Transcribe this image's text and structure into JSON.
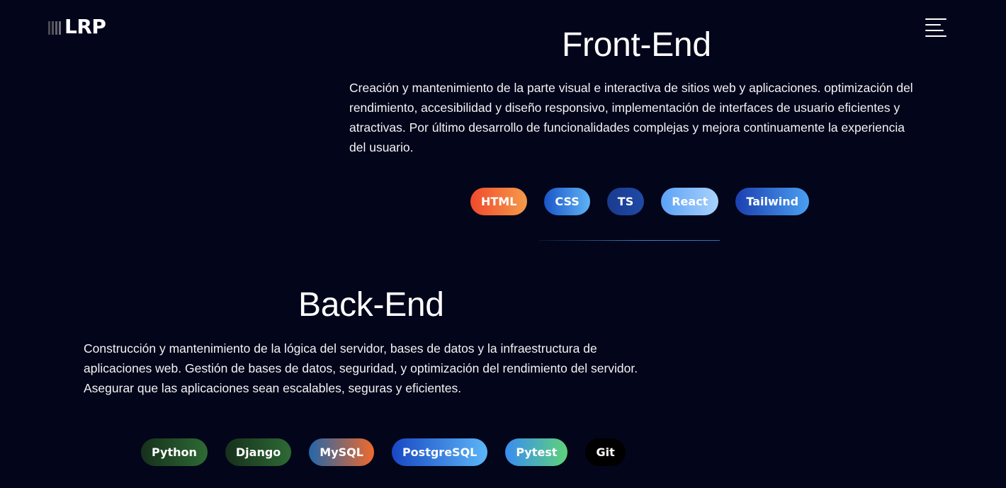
{
  "header": {
    "logo_text": "LRP",
    "menu_icon": "hamburger-menu-icon"
  },
  "frontend": {
    "title": "Front-End",
    "description": "Creación y mantenimiento de la parte visual e interactiva de sitios web y aplicaciones. optimización del rendimiento, accesibilidad y diseño responsivo, implementación de interfaces de usuario eficientes y atractivas. Por último desarrollo de funcionalidades complejas y mejora continuamente la experiencia del usuario.",
    "chips": [
      {
        "label": "HTML",
        "colors": [
          "#ef4b2d",
          "#f59a4a"
        ]
      },
      {
        "label": "CSS",
        "colors": [
          "#1a56c8",
          "#5fb2f5"
        ]
      },
      {
        "label": "TS",
        "colors": [
          "#1a3b8f",
          "#1f4aa6"
        ]
      },
      {
        "label": "React",
        "colors": [
          "#5ca2f7",
          "#a9d2fb"
        ]
      },
      {
        "label": "Tailwind",
        "colors": [
          "#1b3fb0",
          "#4a9ff2"
        ]
      }
    ]
  },
  "backend": {
    "title": "Back-End",
    "description": "Construcción y mantenimiento de la lógica del servidor, bases de datos y la infraestructura de aplicaciones web. Gestión de bases de datos, seguridad, y optimización del rendimiento del servidor. Asegurar que las aplicaciones sean escalables, seguras y eficientes.",
    "chips": [
      {
        "label": "Python",
        "colors": [
          "#16301c",
          "#2e6a35"
        ]
      },
      {
        "label": "Django",
        "colors": [
          "#16301c",
          "#2e6a35"
        ]
      },
      {
        "label": "MySQL",
        "colors": [
          "#2466a8",
          "#ef6a2c"
        ]
      },
      {
        "label": "PostgreSQL",
        "colors": [
          "#1848c4",
          "#5cb6f7"
        ]
      },
      {
        "label": "Pytest",
        "colors": [
          "#3a8cf2",
          "#5ed27a"
        ]
      },
      {
        "label": "Git",
        "colors": [
          "#000000",
          "#000000"
        ]
      }
    ]
  }
}
